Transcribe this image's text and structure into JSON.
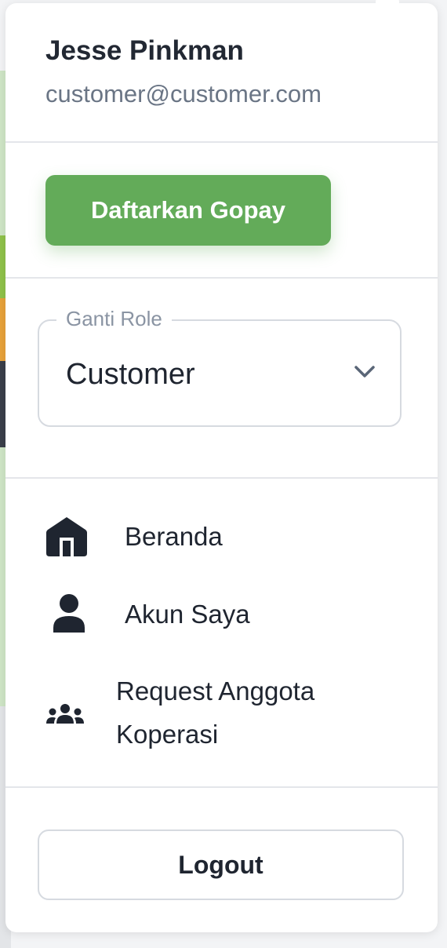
{
  "user": {
    "name": "Jesse Pinkman",
    "email": "customer@customer.com"
  },
  "gopay": {
    "button_label": "Daftarkan Gopay",
    "button_color": "#63ab59"
  },
  "role_select": {
    "legend": "Ganti Role",
    "selected": "Customer",
    "icon": "chevron-down-icon"
  },
  "nav": {
    "items": [
      {
        "label": "Beranda",
        "icon": "home-icon"
      },
      {
        "label": "Akun Saya",
        "icon": "person-icon"
      },
      {
        "label_line1": "Request Anggota",
        "label_line2": "Koperasi",
        "icon": "group-icon"
      }
    ]
  },
  "logout": {
    "label": "Logout"
  }
}
